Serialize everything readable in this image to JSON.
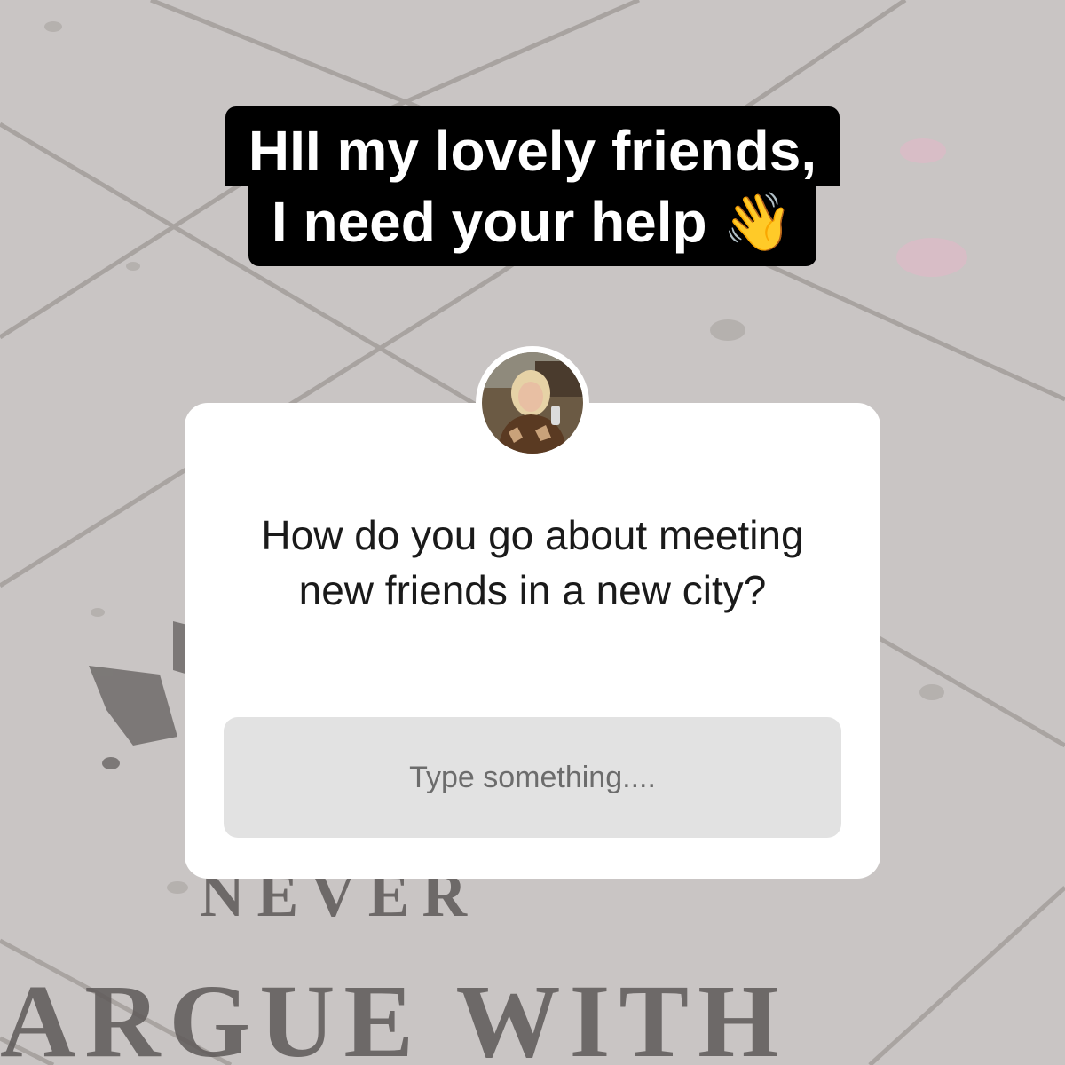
{
  "caption": {
    "line1": "HII my lovely friends,",
    "line2": "I need your help 👋"
  },
  "background": {
    "stencil_word1": "NEVER",
    "stencil_word2": "ARGUE WITH"
  },
  "question_sticker": {
    "question": "How do you go about meeting new friends in a new city?",
    "input_placeholder": "Type something....",
    "avatar_icon": "profile-photo"
  },
  "colors": {
    "caption_bg": "#000000",
    "caption_text": "#ffffff",
    "card_bg": "#ffffff",
    "input_bg": "#e2e2e2"
  }
}
